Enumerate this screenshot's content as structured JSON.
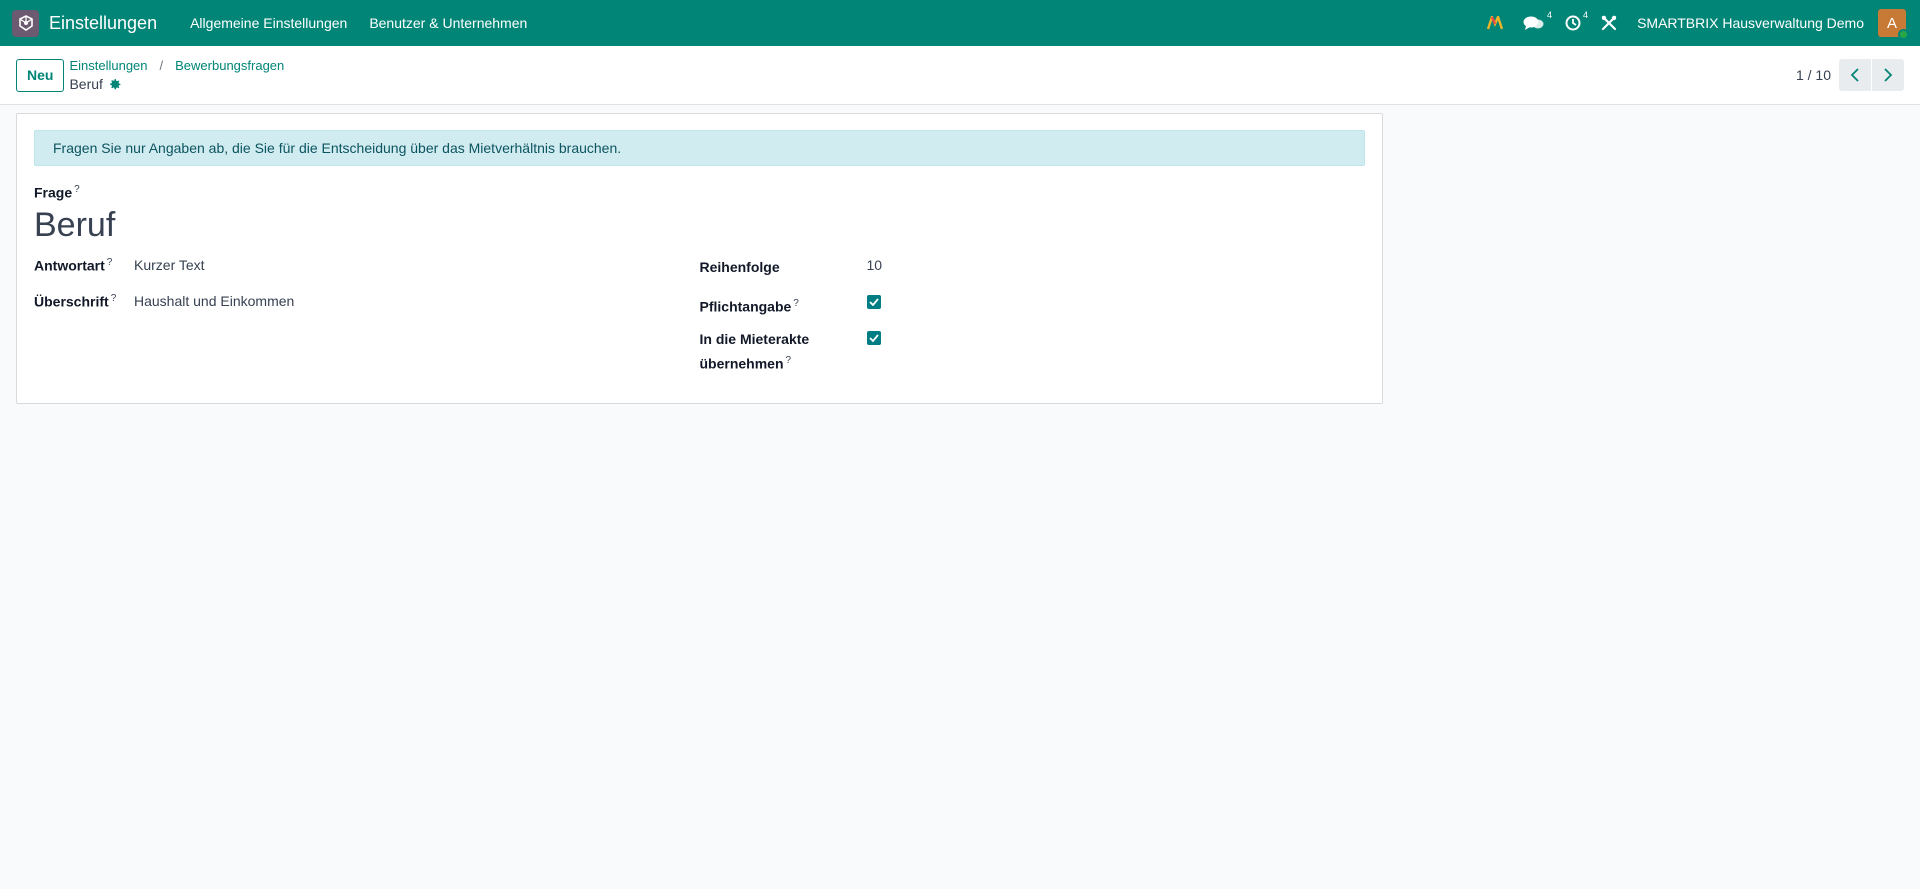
{
  "navbar": {
    "app_name": "Einstellungen",
    "menu": [
      "Allgemeine Einstellungen",
      "Benutzer & Unternehmen"
    ],
    "messages_count": "4",
    "activities_count": "4",
    "company": "SMARTBRIX Hausverwaltung Demo",
    "avatar_letter": "A"
  },
  "control": {
    "new_label": "Neu",
    "breadcrumb": [
      "Einstellungen",
      "Bewerbungsfragen"
    ],
    "breadcrumb_separator": "/",
    "current": "Beruf",
    "pager": "1 / 10"
  },
  "form": {
    "alert": "Fragen Sie nur Angaben ab, die Sie für die Entscheidung über das Mietverhältnis brauchen.",
    "question_label": "Frage",
    "question_value": "Beruf",
    "help_mark": "?",
    "left": {
      "answer_type_label": "Antwortart",
      "answer_type_value": "Kurzer Text",
      "heading_label": "Überschrift",
      "heading_value": "Haushalt und Einkommen"
    },
    "right": {
      "sequence_label": "Reihenfolge",
      "sequence_value": "10",
      "required_label": "Pflichtangabe",
      "required_checked": true,
      "transfer_label_line1": "In die Mieterakte",
      "transfer_label_line2": "übernehmen",
      "transfer_checked": true
    }
  },
  "colors": {
    "primary": "#018577",
    "checkbox": "#017e84",
    "alert_bg": "#d1ecf1"
  }
}
